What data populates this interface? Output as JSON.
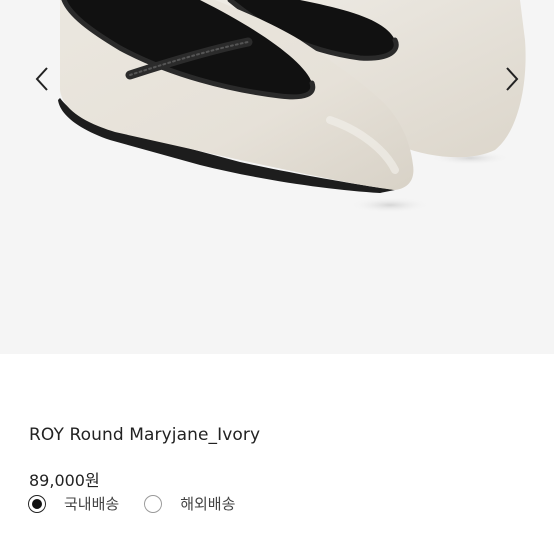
{
  "gallery": {
    "image_name": "product-photo",
    "prev_icon": "chevron-left-icon",
    "next_icon": "chevron-right-icon",
    "background": "#f5f5f5"
  },
  "product": {
    "name": "ROY Round Maryjane_Ivory",
    "price": "89,000원"
  },
  "shipping": {
    "options": [
      {
        "label": "국내배송",
        "selected": true
      },
      {
        "label": "해외배송",
        "selected": false
      }
    ]
  },
  "colors": {
    "shoe_body": "#e9e5dd",
    "shoe_trim": "#2a2a2a",
    "text": "#222222"
  }
}
